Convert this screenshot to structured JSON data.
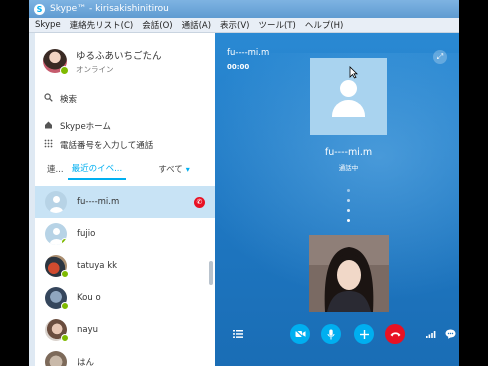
{
  "window": {
    "title": "Skype™ - kirisakishinitirou",
    "logo": "S"
  },
  "menu": [
    "Skype",
    "連絡先リスト(C)",
    "会話(O)",
    "通話(A)",
    "表示(V)",
    "ツール(T)",
    "ヘルプ(H)"
  ],
  "profile": {
    "name": "ゆるふあいちごたん",
    "status": "オンライン"
  },
  "sidebar": {
    "search_label": "検索",
    "home_label": "Skypeホーム",
    "dial_label": "電話番号を入力して通話"
  },
  "tabs": {
    "contacts": "連...",
    "recent": "最近のイベ...",
    "all": "すべて"
  },
  "contacts": [
    {
      "name": "fu----mi.m",
      "avatar": "default",
      "selected": true,
      "in_call": true
    },
    {
      "name": "fujio",
      "avatar": "default",
      "selected": false,
      "in_call": false
    },
    {
      "name": "tatuya kk",
      "avatar": "photo",
      "selected": false,
      "in_call": false
    },
    {
      "name": "Kou o",
      "avatar": "photo",
      "selected": false,
      "in_call": false
    },
    {
      "name": "nayu",
      "avatar": "photo",
      "selected": false,
      "in_call": false
    },
    {
      "name": "はん",
      "avatar": "photo",
      "selected": false,
      "in_call": false
    }
  ],
  "call": {
    "peer_name_top": "fu----mi.m",
    "timer": "00:00",
    "peer_name": "fu----mi.m",
    "status": "通話中"
  },
  "toolbar": {
    "icons": [
      "list-icon",
      "video-off-icon",
      "mic-icon",
      "add-icon",
      "end-call-icon",
      "signal-icon",
      "chat-icon"
    ]
  },
  "colors": {
    "accent": "#00aff0",
    "end_call": "#e81123",
    "online": "#7fba00",
    "call_bg": "#1f79c4"
  }
}
